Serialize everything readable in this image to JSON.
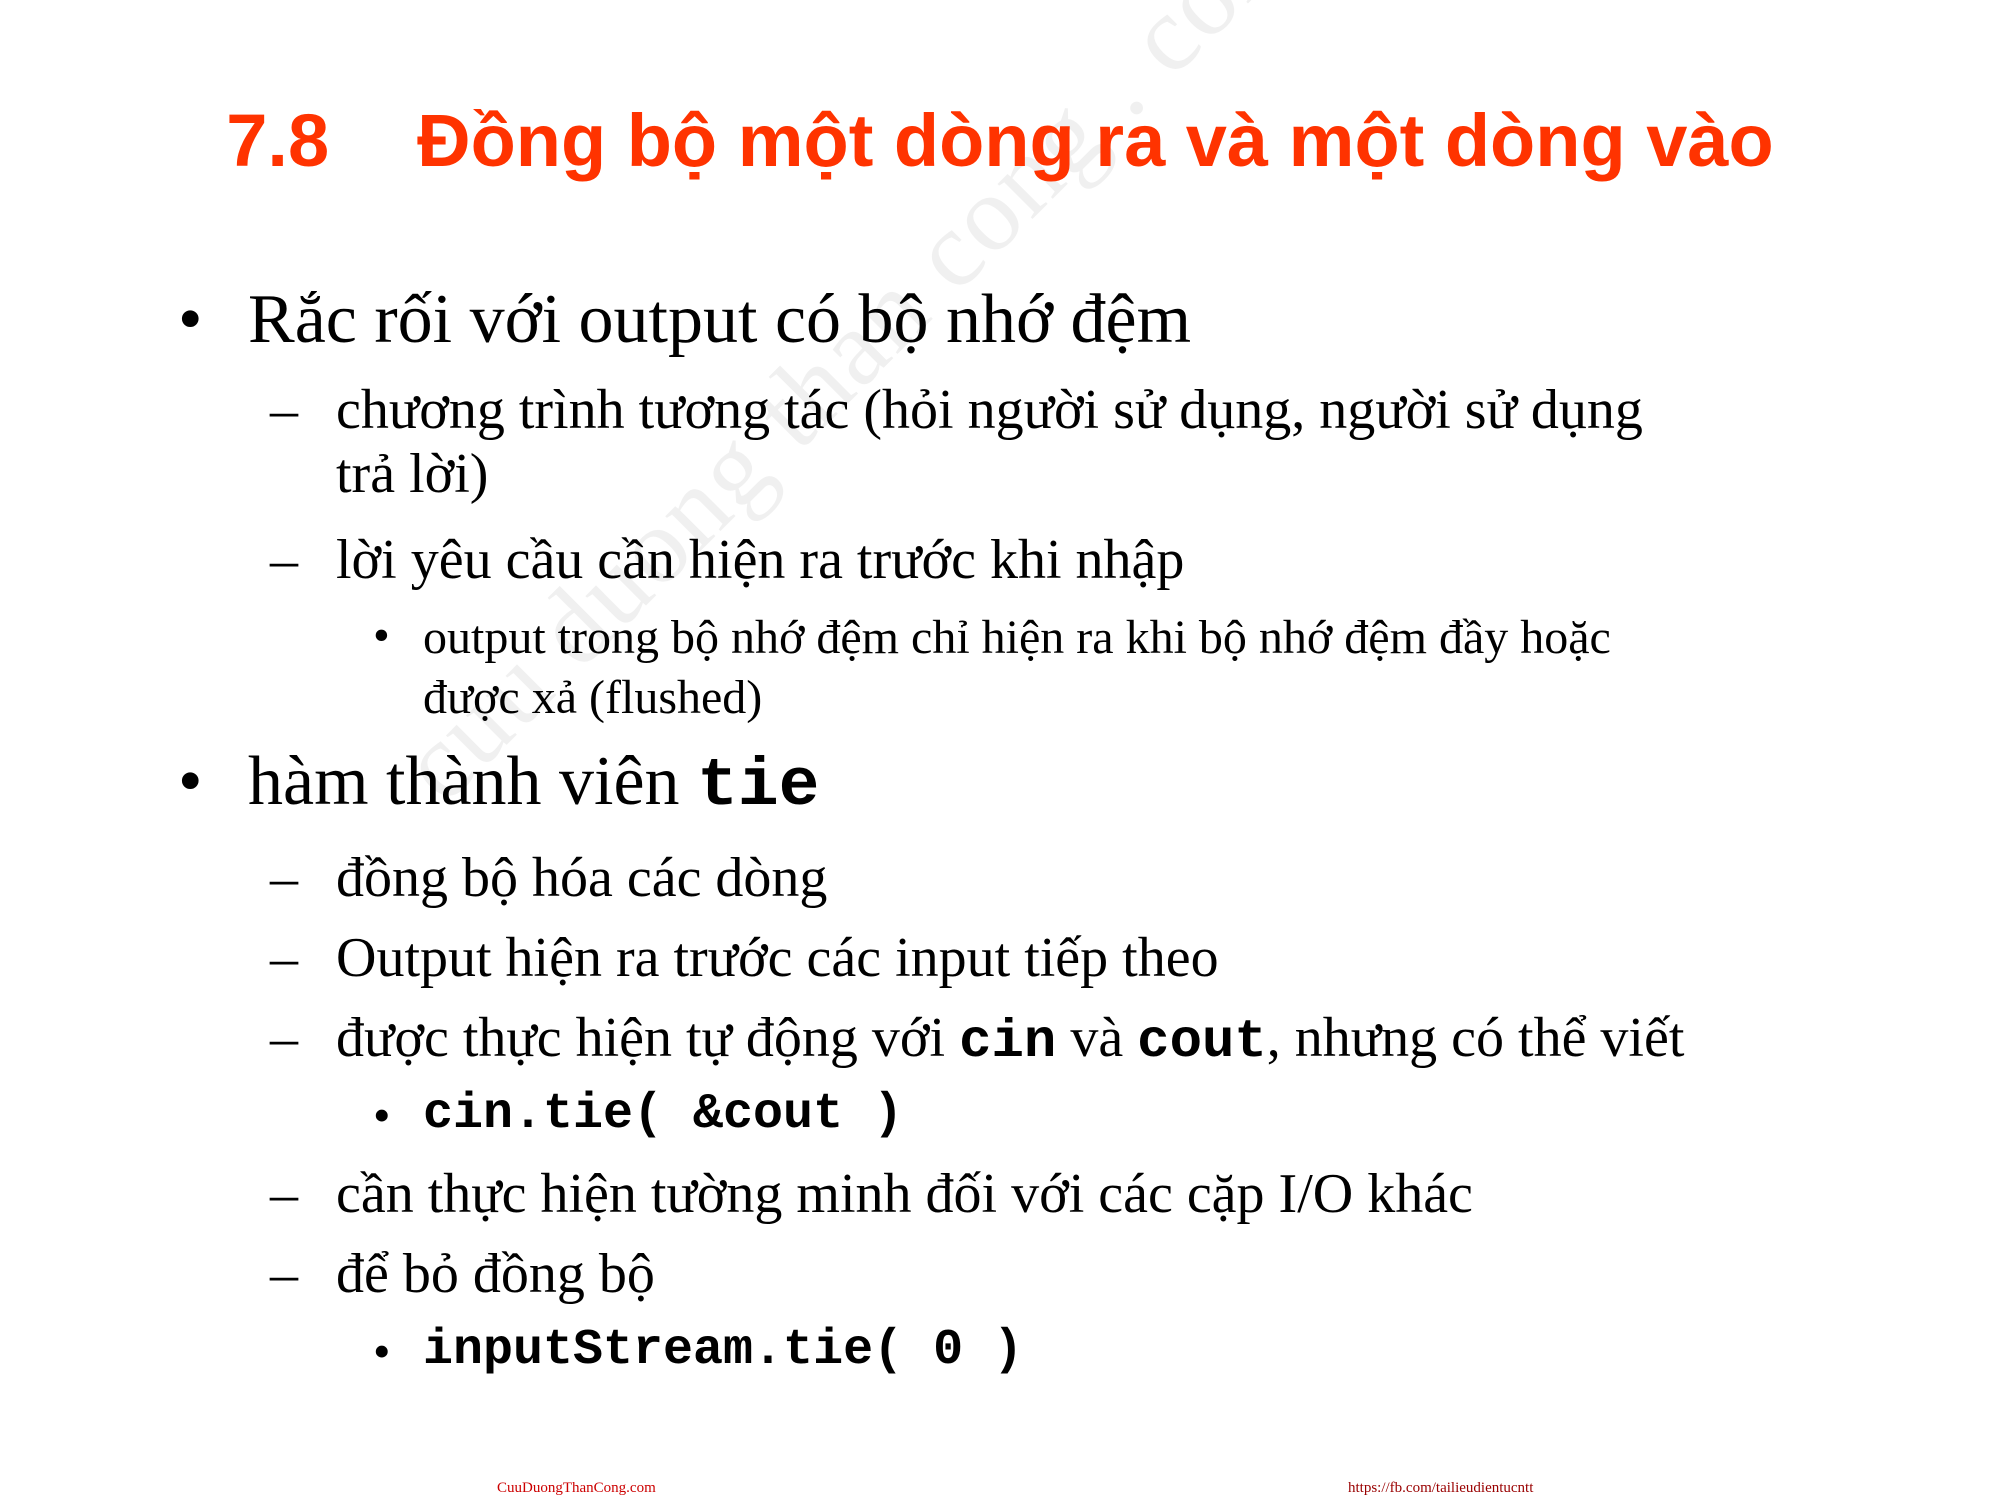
{
  "slide": {
    "title_number": "7.8",
    "title_text": "Đồng bộ một dòng ra và một dòng vào",
    "title_color": "#ff3300",
    "watermark": "cuu duong than cong . com",
    "bullets": [
      {
        "text": "Rắc rối với output có bộ nhớ đệm",
        "subs": [
          {
            "line1": "chương trình tương tác (hỏi người sử dụng, người sử dụng",
            "line2": "trả lời)"
          },
          {
            "line1": "lời yêu cầu cần hiện ra trước khi nhập"
          }
        ],
        "subsub": {
          "line1": "output trong bộ nhớ đệm chỉ hiện ra khi bộ nhớ đệm đầy hoặc",
          "line2": "được xả (flushed)"
        }
      },
      {
        "text_before": "hàm thành viên ",
        "code": "tie",
        "subs": [
          "đồng bộ hóa các dòng",
          "Output hiện ra trước các input tiếp theo"
        ],
        "auto": {
          "part1": "được thực hiện tự động với ",
          "code1": "cin",
          "part2": " và ",
          "code2": "cout",
          "part3": ", nhưng có thể viết"
        },
        "code_example1": "cin.tie( &cout )",
        "subs2": [
          "cần thực hiện tường minh đối với các cặp I/O khác",
          "để bỏ đồng bộ"
        ],
        "code_example2": "inputStream.tie( 0 )"
      }
    ],
    "bullet_glyph": "•",
    "dash_glyph": "–"
  },
  "footer": {
    "left": "CuuDuongThanCong.com",
    "right": "https://fb.com/tailieudientucntt"
  }
}
